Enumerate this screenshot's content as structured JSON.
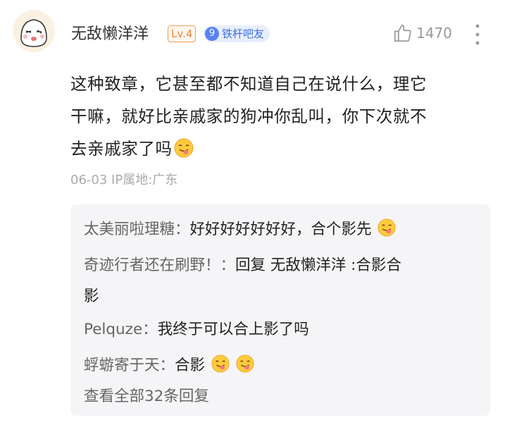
{
  "comment": {
    "username": "无敌懒洋洋",
    "level_badge": "Lv.4",
    "fan_badge": {
      "level": "9",
      "label": "铁杆吧友"
    },
    "likes": "1470",
    "text_lines": [
      "这种致章，它甚至都不知道自己在说什么，理它",
      "干嘛，就好比亲戚家的狗冲你乱叫，你下次就不",
      "去亲戚家了吗"
    ],
    "date": "06-03",
    "ip_location": "IP属地:广东"
  },
  "replies": [
    {
      "author": "太美丽啦理糖：",
      "text": "好好好好好好好，合个影先",
      "emoji_count": 1
    },
    {
      "author": "奇迹行者还在刷野！：",
      "text": "回复 无敌懒洋洋 :合影合",
      "text_cont": "影",
      "emoji_count": 0
    },
    {
      "author": "Pelquze：",
      "text": "我终于可以合上影了吗",
      "emoji_count": 0
    },
    {
      "author": "蜉蝣寄于天：",
      "text": "合影",
      "emoji_count": 2
    }
  ],
  "view_all_label": "查看全部32条回复",
  "icons": {
    "avatar": "cartoon-face-avatar",
    "like": "thumbs-up-icon",
    "more": "more-vertical-icon",
    "emoji": "tongue-out-emoji-icon"
  },
  "colors": {
    "level_badge": "#e8893a",
    "fan_badge": "#3d6de0",
    "reply_bg": "#f5f5f7",
    "muted": "#999999"
  }
}
